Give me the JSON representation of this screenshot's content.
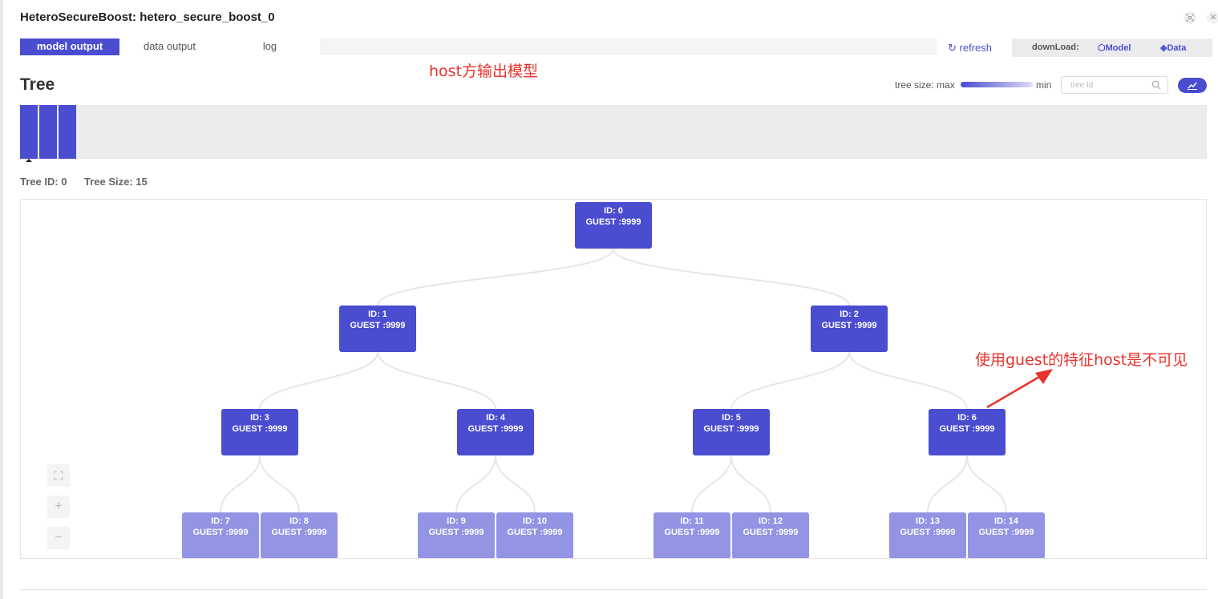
{
  "header": {
    "title": "HeteroSecureBoost: hetero_secure_boost_0"
  },
  "window_controls": {
    "fullscreen_icon": "expand-icon",
    "close_icon": "close-icon"
  },
  "tabs": [
    {
      "label": "model output",
      "active": true
    },
    {
      "label": "data output",
      "active": false
    },
    {
      "label": "log",
      "active": false
    }
  ],
  "toolbar": {
    "refresh_label": "refresh",
    "download_label": "downLoad:",
    "model_label": "Model",
    "data_label": "Data"
  },
  "annotations": {
    "top": "host方输出模型",
    "right": "使用guest的特征host是不可见"
  },
  "tree_section": {
    "title": "Tree",
    "size_label_max": "tree size: max",
    "size_label_min": "min",
    "search_placeholder": "tree Id",
    "tree_count": 3,
    "selected_tree": 0
  },
  "tree_info": {
    "id_label": "Tree ID:  0",
    "size_label": "Tree Size:  15"
  },
  "colors": {
    "accent": "#4a4dd0",
    "leaf": "#9394e4",
    "annotation": "#e8322c"
  },
  "nodes": [
    {
      "id": "ID: 0",
      "label": "GUEST :9999",
      "type": "internal"
    },
    {
      "id": "ID: 1",
      "label": "GUEST :9999",
      "type": "internal"
    },
    {
      "id": "ID: 2",
      "label": "GUEST :9999",
      "type": "internal"
    },
    {
      "id": "ID: 3",
      "label": "GUEST :9999",
      "type": "internal"
    },
    {
      "id": "ID: 4",
      "label": "GUEST :9999",
      "type": "internal"
    },
    {
      "id": "ID: 5",
      "label": "GUEST :9999",
      "type": "internal"
    },
    {
      "id": "ID: 6",
      "label": "GUEST :9999",
      "type": "internal"
    },
    {
      "id": "ID: 7",
      "label": "GUEST :9999",
      "type": "leaf"
    },
    {
      "id": "ID: 8",
      "label": "GUEST :9999",
      "type": "leaf"
    },
    {
      "id": "ID: 9",
      "label": "GUEST :9999",
      "type": "leaf"
    },
    {
      "id": "ID: 10",
      "label": "GUEST :9999",
      "type": "leaf"
    },
    {
      "id": "ID: 11",
      "label": "GUEST :9999",
      "type": "leaf"
    },
    {
      "id": "ID: 12",
      "label": "GUEST :9999",
      "type": "leaf"
    },
    {
      "id": "ID: 13",
      "label": "GUEST :9999",
      "type": "leaf"
    },
    {
      "id": "ID: 14",
      "label": "GUEST :9999",
      "type": "leaf"
    }
  ],
  "zoom_controls": {
    "fit_icon": "fit-screen-icon",
    "zoom_in_icon": "plus-icon",
    "zoom_out_icon": "minus-icon"
  }
}
